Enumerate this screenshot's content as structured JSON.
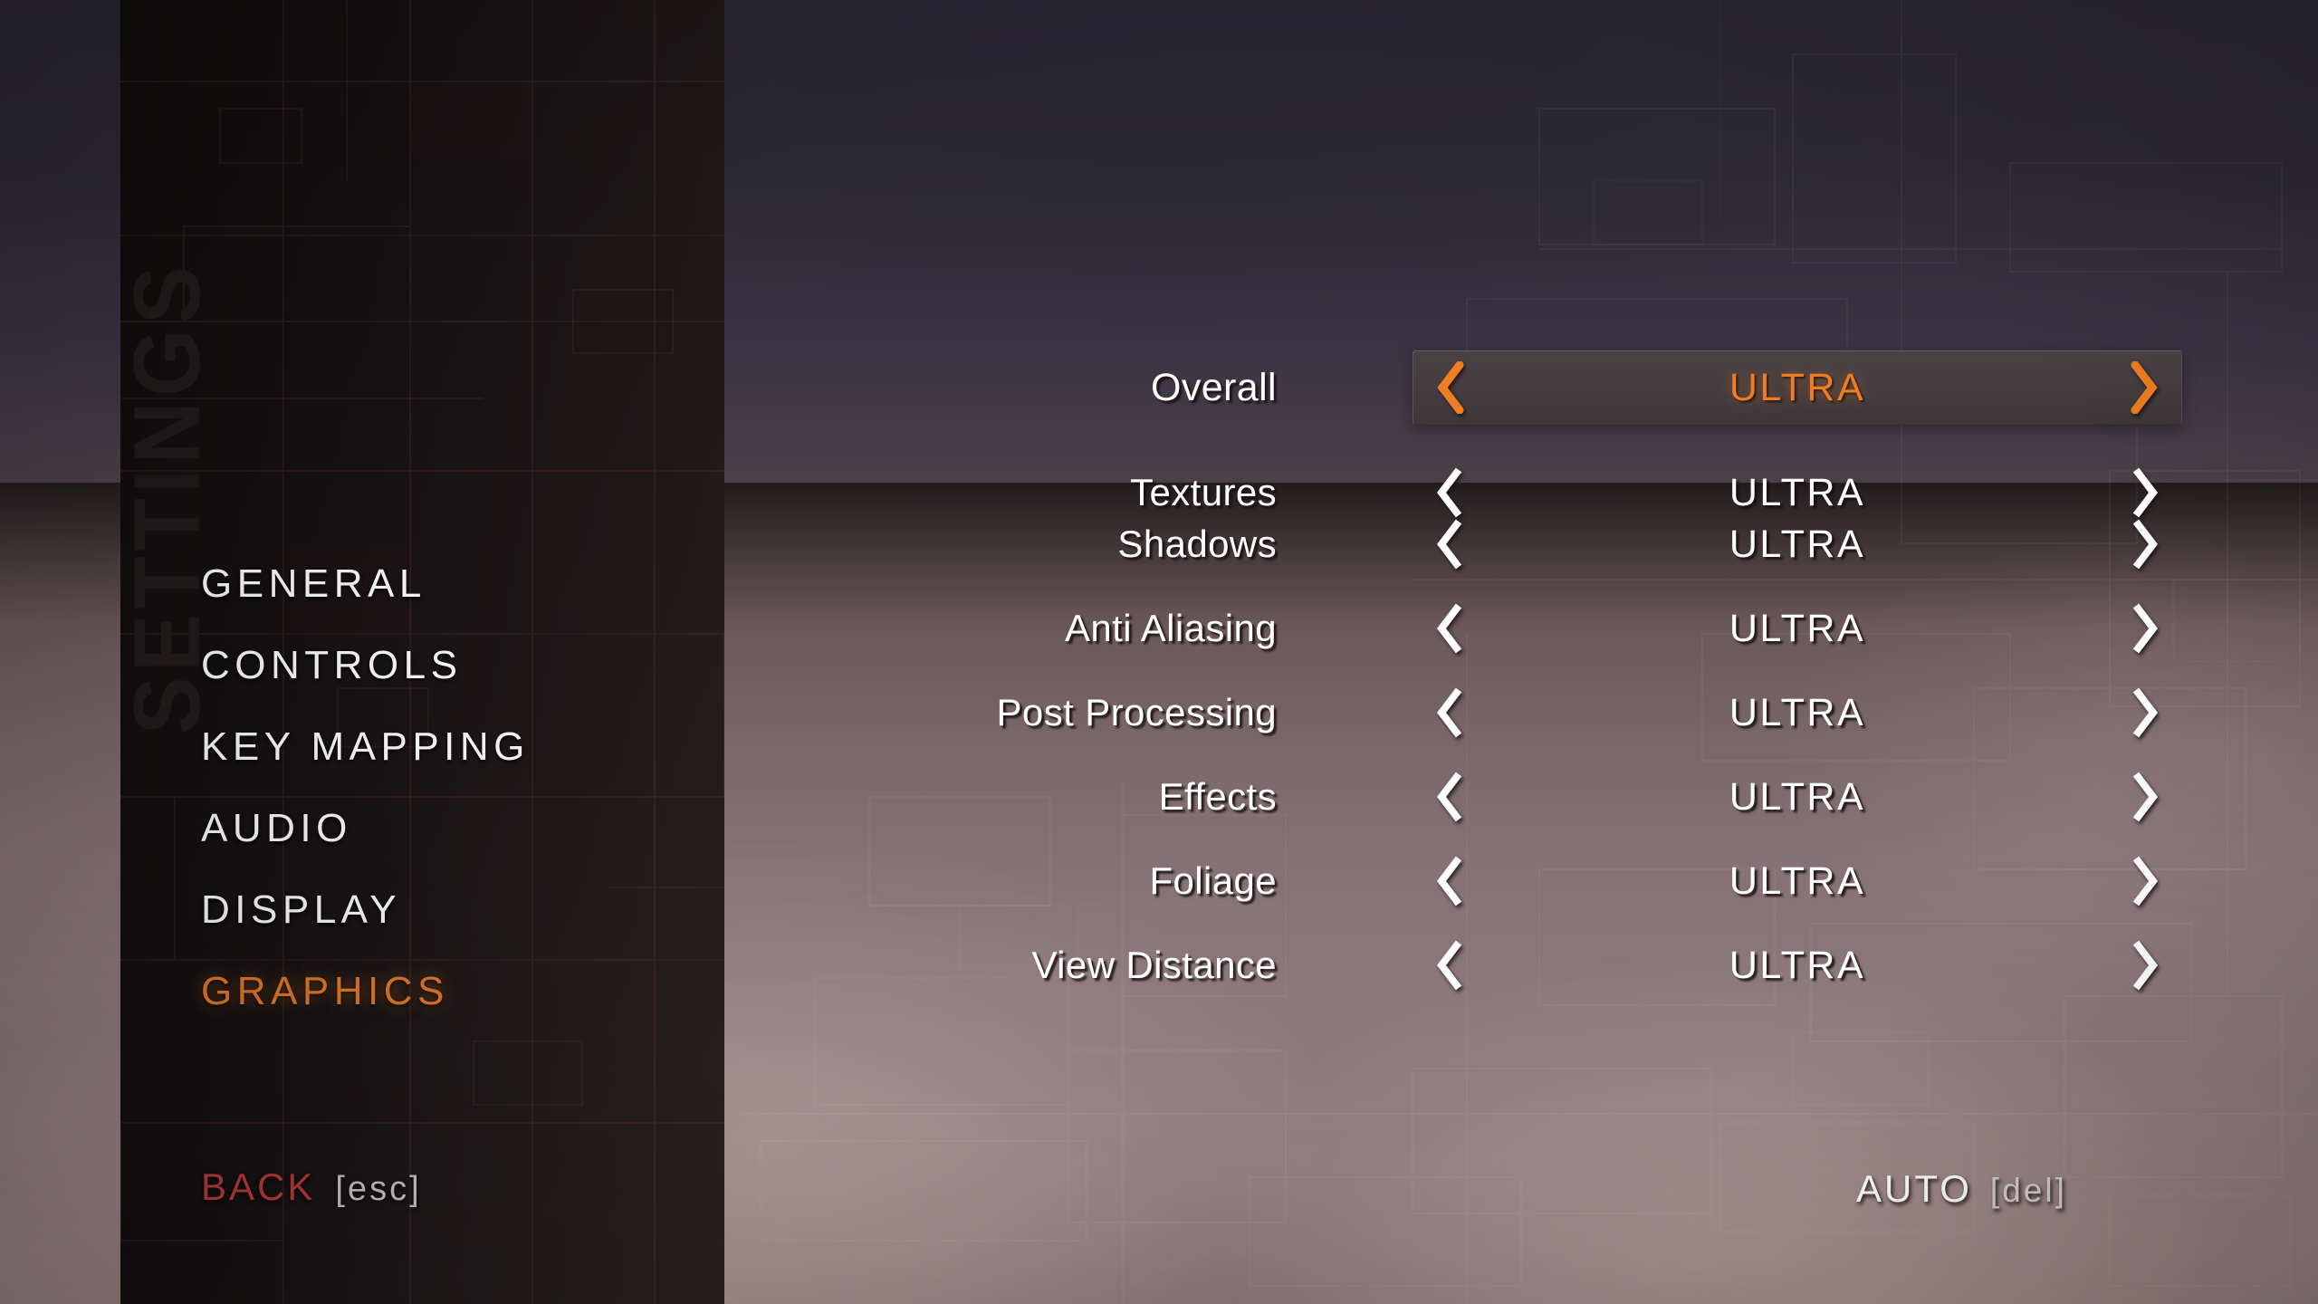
{
  "window": {
    "vertical_title": "SETTINGS"
  },
  "sidebar": {
    "items": [
      {
        "label": "GENERAL",
        "active": false
      },
      {
        "label": "CONTROLS",
        "active": false
      },
      {
        "label": "KEY  MAPPING",
        "active": false
      },
      {
        "label": "AUDIO",
        "active": false
      },
      {
        "label": "DISPLAY",
        "active": false
      },
      {
        "label": "GRAPHICS",
        "active": true
      }
    ],
    "back": {
      "label": "BACK",
      "hotkey": "[esc]"
    }
  },
  "footer": {
    "auto": {
      "label": "AUTO",
      "hotkey": "[del]"
    }
  },
  "icons": {
    "left_chevron": "chevron-left-icon",
    "right_chevron": "chevron-right-icon"
  },
  "colors": {
    "accent_orange": "#ef7d23",
    "nav_active_orange": "#d9752a",
    "back_red": "#b63a3b",
    "text_white": "#ffffff",
    "panel_black": "#141011",
    "selected_box": "#453e41"
  },
  "settings": {
    "rows": [
      {
        "label": "Overall",
        "value": "ULTRA",
        "selected": true
      },
      {
        "label": "Textures",
        "value": "ULTRA",
        "selected": false
      },
      {
        "label": "Shadows",
        "value": "ULTRA",
        "selected": false
      },
      {
        "label": "Anti Aliasing",
        "value": "ULTRA",
        "selected": false
      },
      {
        "label": "Post Processing",
        "value": "ULTRA",
        "selected": false
      },
      {
        "label": "Effects",
        "value": "ULTRA",
        "selected": false
      },
      {
        "label": "Foliage",
        "value": "ULTRA",
        "selected": false
      },
      {
        "label": "View Distance",
        "value": "ULTRA",
        "selected": false
      }
    ]
  }
}
